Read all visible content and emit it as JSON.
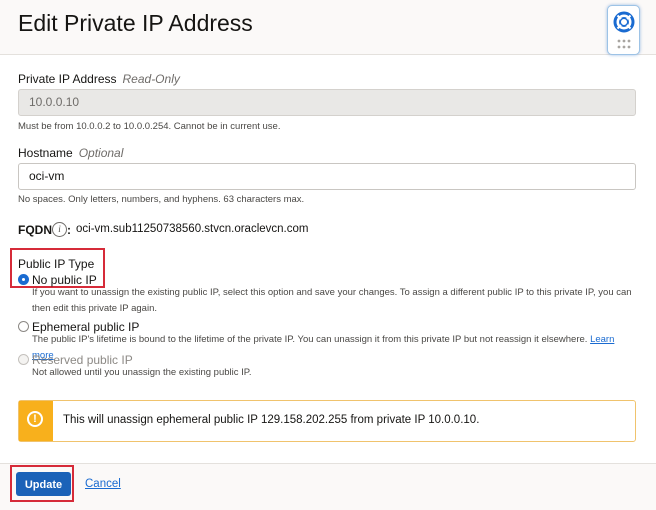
{
  "dialog": {
    "title": "Edit Private IP Address"
  },
  "private_ip": {
    "label": "Private IP Address",
    "hint": "Read-Only",
    "value": "10.0.0.10",
    "help": "Must be from 10.0.0.2 to 10.0.0.254. Cannot be in current use."
  },
  "hostname": {
    "label": "Hostname",
    "hint": "Optional",
    "value": "oci-vm",
    "help": "No spaces. Only letters, numbers, and hyphens. 63 characters max."
  },
  "fqdn": {
    "label": "FQDN",
    "info_glyph": "i",
    "separator": ":",
    "value": "oci-vm.sub11250738560.stvcn.oraclevcn.com"
  },
  "public_ip_type": {
    "label": "Public IP Type",
    "options": [
      {
        "label": "No public IP",
        "selected": true,
        "disabled": false,
        "description": "If you want to unassign the existing public IP, select this option and save your changes. To assign a different public IP to this private IP, you can then edit this private IP again."
      },
      {
        "label": "Ephemeral public IP",
        "selected": false,
        "disabled": false,
        "description": "The public IP's lifetime is bound to the lifetime of the private IP. You can unassign it from this private IP but not reassign it elsewhere.",
        "link": "Learn more"
      },
      {
        "label": "Reserved public IP",
        "selected": false,
        "disabled": true,
        "description": "Not allowed until you unassign the existing public IP."
      }
    ]
  },
  "warning": {
    "icon": "exclamation-icon",
    "glyph": "!",
    "text": "This will unassign ephemeral public IP 129.158.202.255 from private IP 10.0.0.10."
  },
  "footer": {
    "update_label": "Update",
    "cancel_label": "Cancel"
  },
  "colors": {
    "primary": "#1b62b8",
    "link": "#1a6bd1",
    "warning": "#f8b01c",
    "highlight": "#d62b39"
  }
}
